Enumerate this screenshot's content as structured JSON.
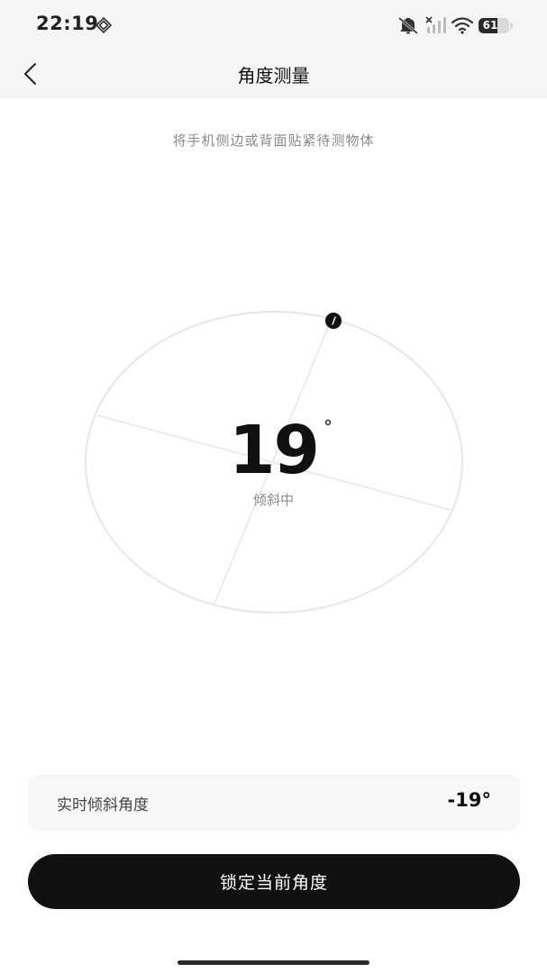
{
  "status_bar": {
    "time": "22:19",
    "battery": "61",
    "battery_level": 0.61,
    "icons": [
      "sync-icon",
      "mute-icon",
      "signal-no-sim-icon",
      "wifi-icon",
      "battery-icon"
    ]
  },
  "nav": {
    "title": "角度测量",
    "back_icon": "chevron-left-icon"
  },
  "hint": "将手机侧边或背面贴紧待测物体",
  "dial": {
    "angle_value": "19",
    "degree_symbol": "°",
    "status": "倾斜中",
    "tilt_degrees": 19
  },
  "realtime": {
    "label": "实时倾斜角度",
    "value": "-19°"
  },
  "action": {
    "lock_label": "锁定当前角度"
  },
  "colors": {
    "accent": "#111111",
    "bar_bg": "#f5f5f5",
    "card_bg": "#f7f7f8",
    "dial_line": "#e6e6e6",
    "muted_text": "#8a8a8a"
  }
}
